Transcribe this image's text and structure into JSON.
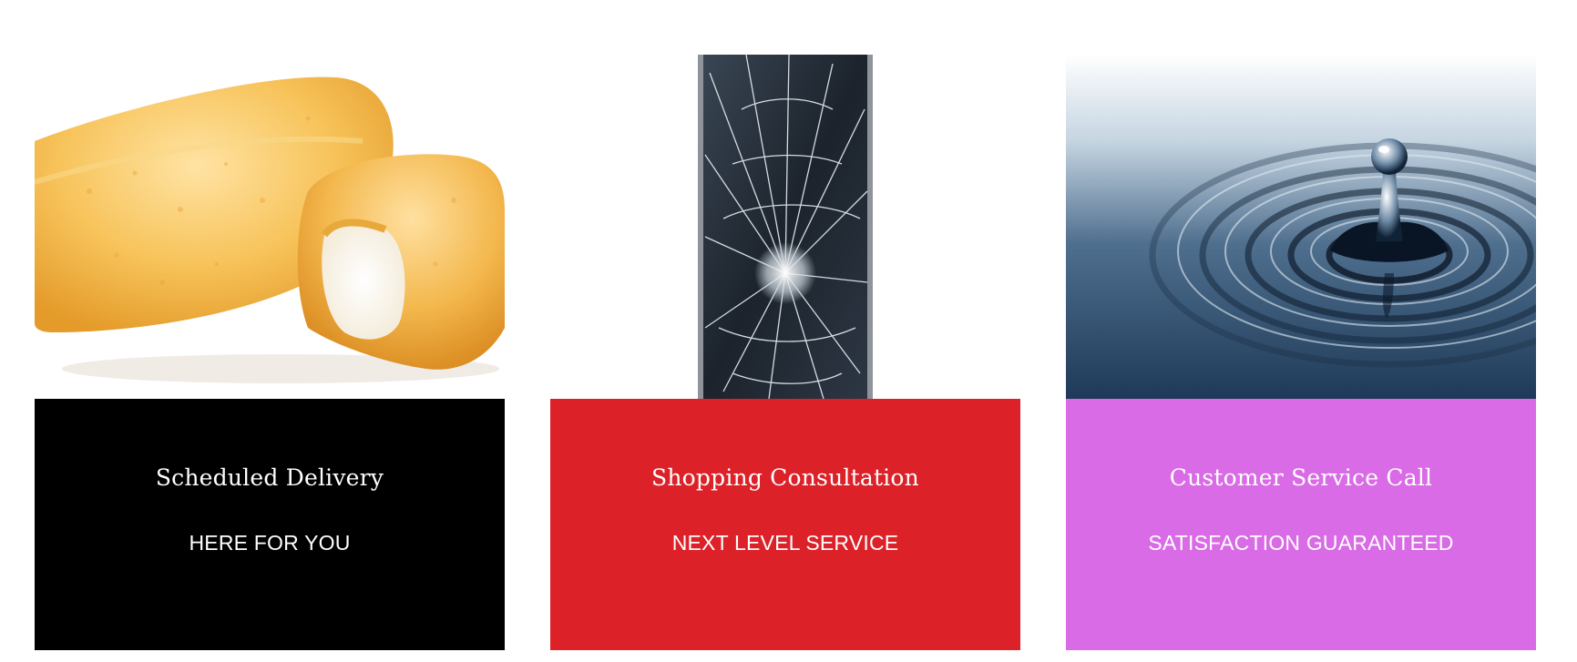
{
  "cards": [
    {
      "title": "Scheduled Delivery",
      "subtitle": "HERE FOR YOU",
      "image_icon": "snack-cake-image",
      "panel_color": "#000000"
    },
    {
      "title": "Shopping Consultation",
      "subtitle": "NEXT LEVEL SERVICE",
      "image_icon": "cracked-phone-image",
      "panel_color": "#dc2128"
    },
    {
      "title": "Customer Service Call",
      "subtitle": "SATISFACTION GUARANTEED",
      "image_icon": "water-drop-image",
      "panel_color": "#d96be6"
    }
  ]
}
